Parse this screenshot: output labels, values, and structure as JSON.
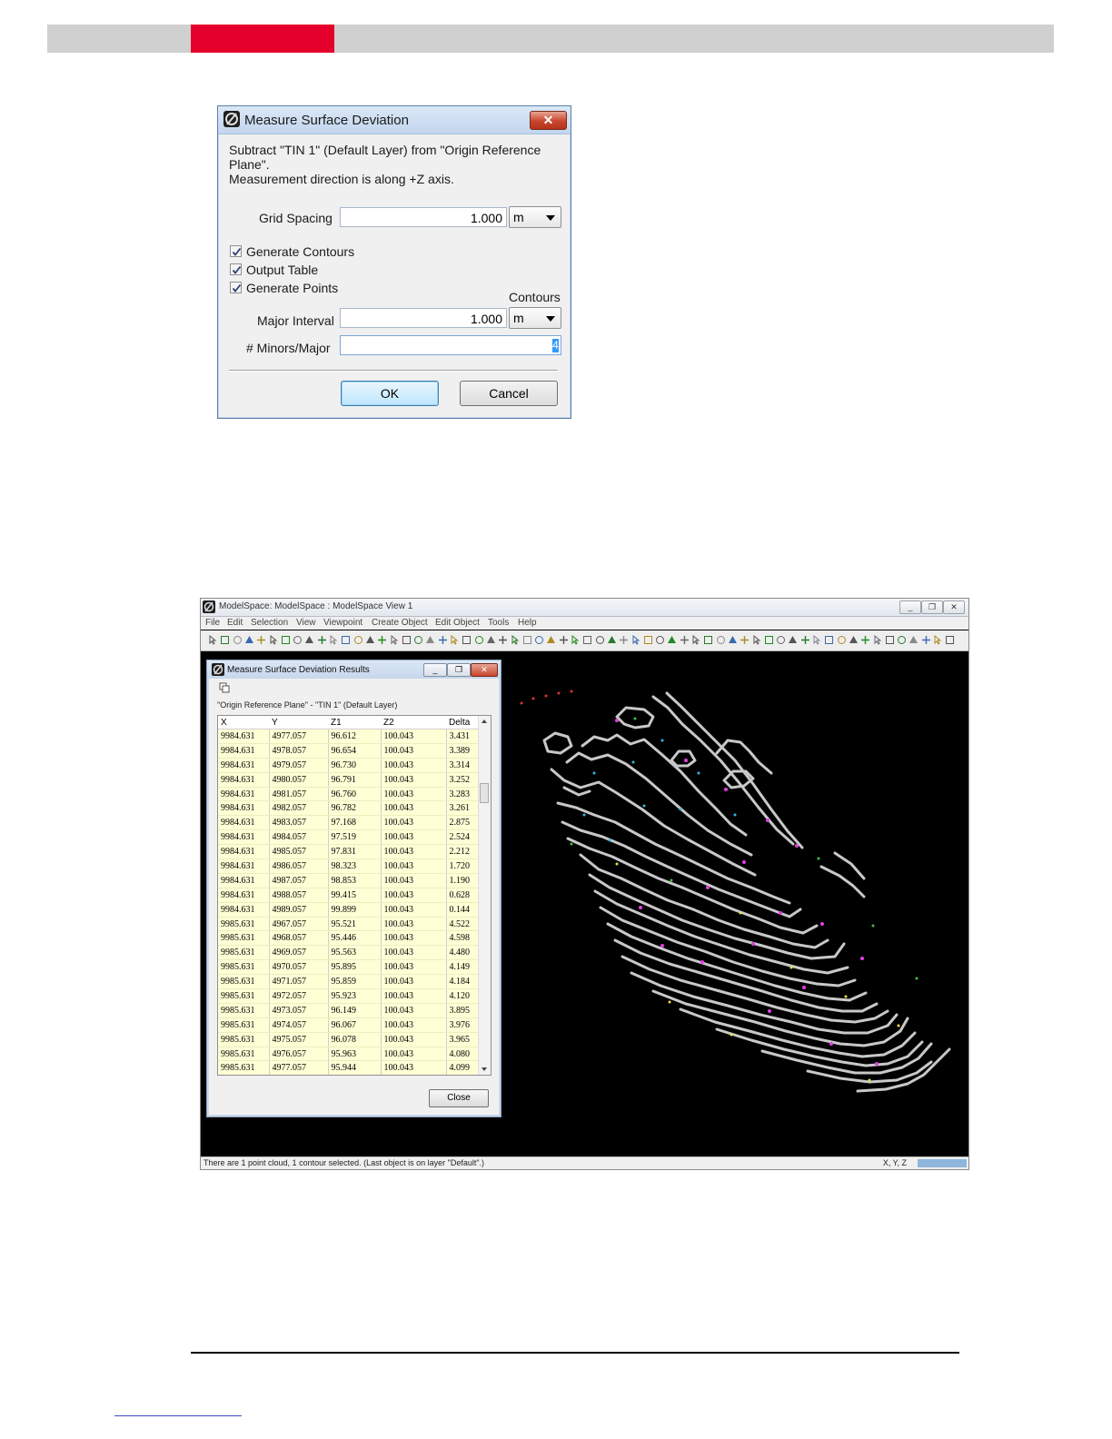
{
  "dialog": {
    "title": "Measure Surface Deviation",
    "message_line1": "Subtract \"TIN 1\" (Default Layer) from \"Origin Reference",
    "message_line2": "Plane\".",
    "message_line3": "Measurement direction is along +Z axis.",
    "grid_spacing_label": "Grid Spacing",
    "grid_spacing_value": "1.000",
    "grid_spacing_unit": "m",
    "generate_contours_label": "Generate Contours",
    "output_table_label": "Output Table",
    "generate_points_label": "Generate Points",
    "contours_section_label": "Contours",
    "major_interval_label": "Major Interval",
    "major_interval_value": "1.000",
    "major_interval_unit": "m",
    "minors_label": "# Minors/Major",
    "minors_value": "4",
    "ok_label": "OK",
    "cancel_label": "Cancel",
    "close_glyph": "✕"
  },
  "modelspace": {
    "title": "ModelSpace: ModelSpace  : ModelSpace  View 1",
    "menu": [
      "File",
      "Edit",
      "Selection",
      "View",
      "Viewpoint",
      "Create Object",
      "Edit Object",
      "Tools",
      "Help"
    ],
    "status_text": "There are 1 point cloud, 1 contour selected. (Last object is on layer \"Default\".)",
    "status_coords": "X, Y, Z",
    "win_min": "_",
    "win_max": "❐",
    "win_close": "✕"
  },
  "results": {
    "title": "Measure Surface Deviation Results",
    "subtitle": "\"Origin Reference Plane\" - \"TIN 1\" (Default Layer)",
    "close_label": "Close",
    "columns": [
      "X",
      "Y",
      "Z1",
      "Z2",
      "Delta"
    ],
    "rows": [
      [
        "9984.631",
        "4977.057",
        "96.612",
        "100.043",
        "3.431"
      ],
      [
        "9984.631",
        "4978.057",
        "96.654",
        "100.043",
        "3.389"
      ],
      [
        "9984.631",
        "4979.057",
        "96.730",
        "100.043",
        "3.314"
      ],
      [
        "9984.631",
        "4980.057",
        "96.791",
        "100.043",
        "3.252"
      ],
      [
        "9984.631",
        "4981.057",
        "96.760",
        "100.043",
        "3.283"
      ],
      [
        "9984.631",
        "4982.057",
        "96.782",
        "100.043",
        "3.261"
      ],
      [
        "9984.631",
        "4983.057",
        "97.168",
        "100.043",
        "2.875"
      ],
      [
        "9984.631",
        "4984.057",
        "97.519",
        "100.043",
        "2.524"
      ],
      [
        "9984.631",
        "4985.057",
        "97.831",
        "100.043",
        "2.212"
      ],
      [
        "9984.631",
        "4986.057",
        "98.323",
        "100.043",
        "1.720"
      ],
      [
        "9984.631",
        "4987.057",
        "98.853",
        "100.043",
        "1.190"
      ],
      [
        "9984.631",
        "4988.057",
        "99.415",
        "100.043",
        "0.628"
      ],
      [
        "9984.631",
        "4989.057",
        "99.899",
        "100.043",
        "0.144"
      ],
      [
        "9985.631",
        "4967.057",
        "95.521",
        "100.043",
        "4.522"
      ],
      [
        "9985.631",
        "4968.057",
        "95.446",
        "100.043",
        "4.598"
      ],
      [
        "9985.631",
        "4969.057",
        "95.563",
        "100.043",
        "4.480"
      ],
      [
        "9985.631",
        "4970.057",
        "95.895",
        "100.043",
        "4.149"
      ],
      [
        "9985.631",
        "4971.057",
        "95.859",
        "100.043",
        "4.184"
      ],
      [
        "9985.631",
        "4972.057",
        "95.923",
        "100.043",
        "4.120"
      ],
      [
        "9985.631",
        "4973.057",
        "96.149",
        "100.043",
        "3.895"
      ],
      [
        "9985.631",
        "4974.057",
        "96.067",
        "100.043",
        "3.976"
      ],
      [
        "9985.631",
        "4975.057",
        "96.078",
        "100.043",
        "3.965"
      ],
      [
        "9985.631",
        "4976.057",
        "95.963",
        "100.043",
        "4.080"
      ],
      [
        "9985.631",
        "4977.057",
        "95.944",
        "100.043",
        "4.099"
      ]
    ]
  },
  "colors": {
    "header_red": "#e4002b",
    "header_gray": "#d0d0d0",
    "table_cell_bg": "#ffffd6",
    "viewport_bg": "#000000",
    "contour_color": "#c8c8c8"
  }
}
